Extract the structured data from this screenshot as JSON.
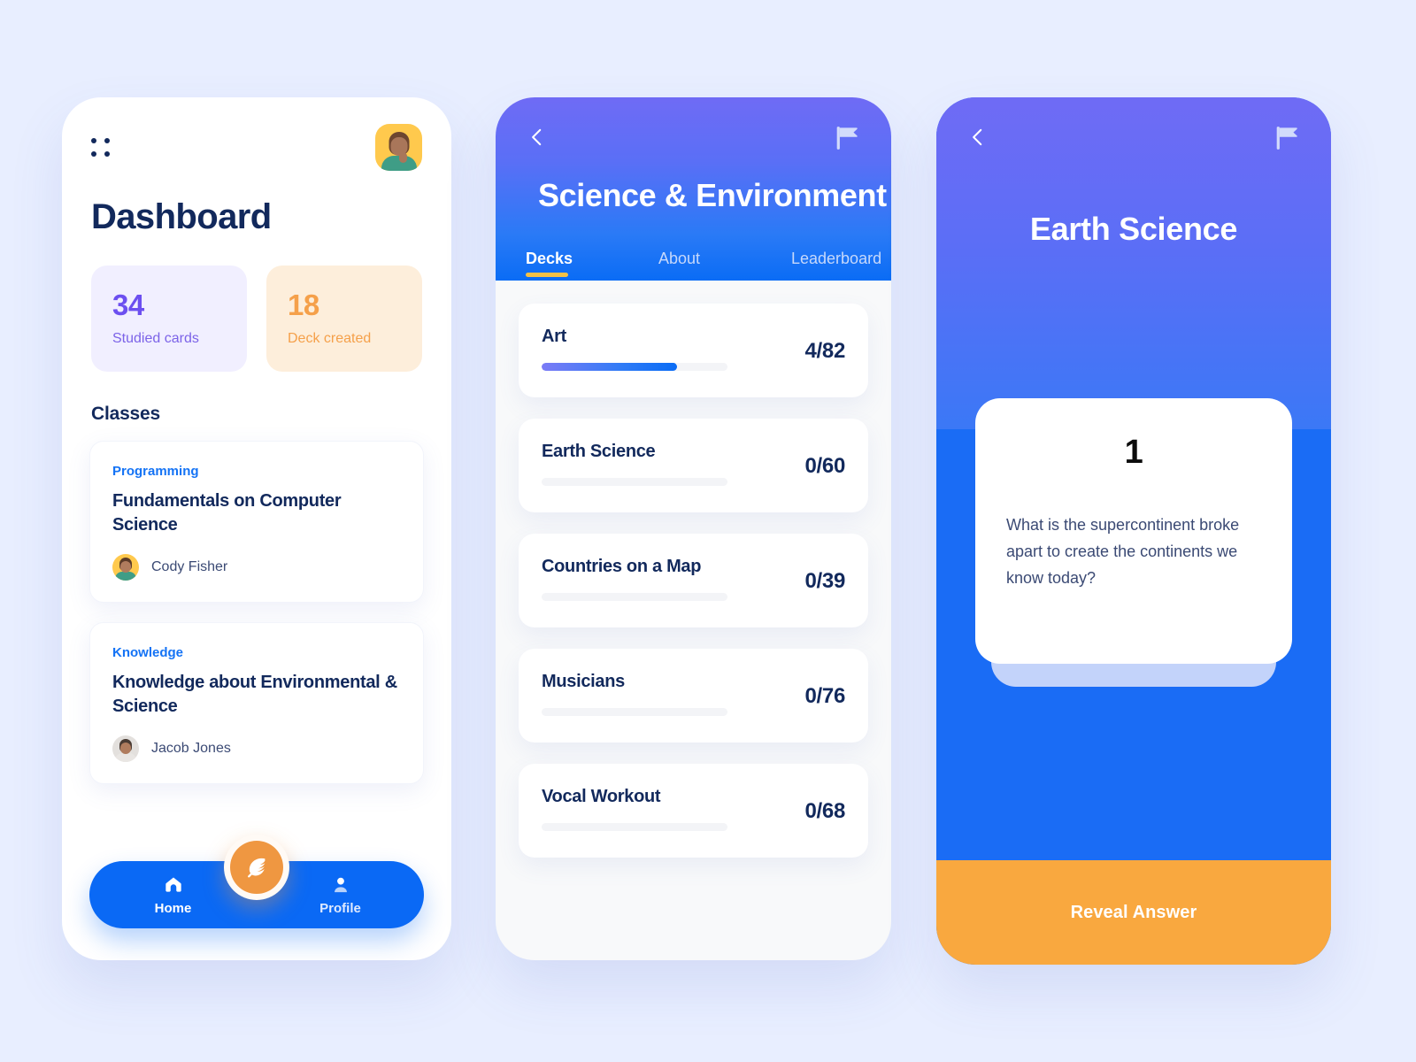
{
  "app": {
    "background_color": "#e8eeff",
    "accent_blue": "#0a69f5",
    "accent_orange": "#f9a83f",
    "accent_purple": "#6c4ff0"
  },
  "phone1": {
    "menu_icon": "grid-dots-icon",
    "avatar_icon": "user-avatar",
    "title": "Dashboard",
    "stats": [
      {
        "value": "34",
        "label": "Studied cards",
        "color": "#6c4ff0"
      },
      {
        "value": "18",
        "label": "Deck created",
        "color": "#f5a04a"
      }
    ],
    "section_title": "Classes",
    "classes": [
      {
        "category": "Programming",
        "name": "Fundamentals on Computer Science",
        "teacher": "Cody Fisher"
      },
      {
        "category": "Knowledge",
        "name": "Knowledge about Environmental & Science",
        "teacher": "Jacob Jones"
      }
    ],
    "nav": {
      "home_label": "Home",
      "profile_label": "Profile",
      "fab_icon": "feather-icon"
    }
  },
  "phone2": {
    "back_icon": "chevron-left-icon",
    "flag_icon": "flag-icon",
    "title": "Science & Environment",
    "tabs": [
      {
        "label": "Decks",
        "active": true
      },
      {
        "label": "About",
        "active": false
      },
      {
        "label": "Leaderboard",
        "active": false
      }
    ],
    "decks": [
      {
        "name": "Art",
        "count": "4/82",
        "progress": 73
      },
      {
        "name": "Earth Science",
        "count": "0/60",
        "progress": 0
      },
      {
        "name": "Countries on a Map",
        "count": "0/39",
        "progress": 0
      },
      {
        "name": "Musicians",
        "count": "0/76",
        "progress": 0
      },
      {
        "name": "Vocal Workout",
        "count": "0/68",
        "progress": 0
      }
    ]
  },
  "phone3": {
    "back_icon": "chevron-left-icon",
    "flag_icon": "flag-icon",
    "title": "Earth Science",
    "card_number": "1",
    "question": "What is the supercontinent broke apart to create the continents we know today?",
    "reveal_label": "Reveal Answer"
  }
}
